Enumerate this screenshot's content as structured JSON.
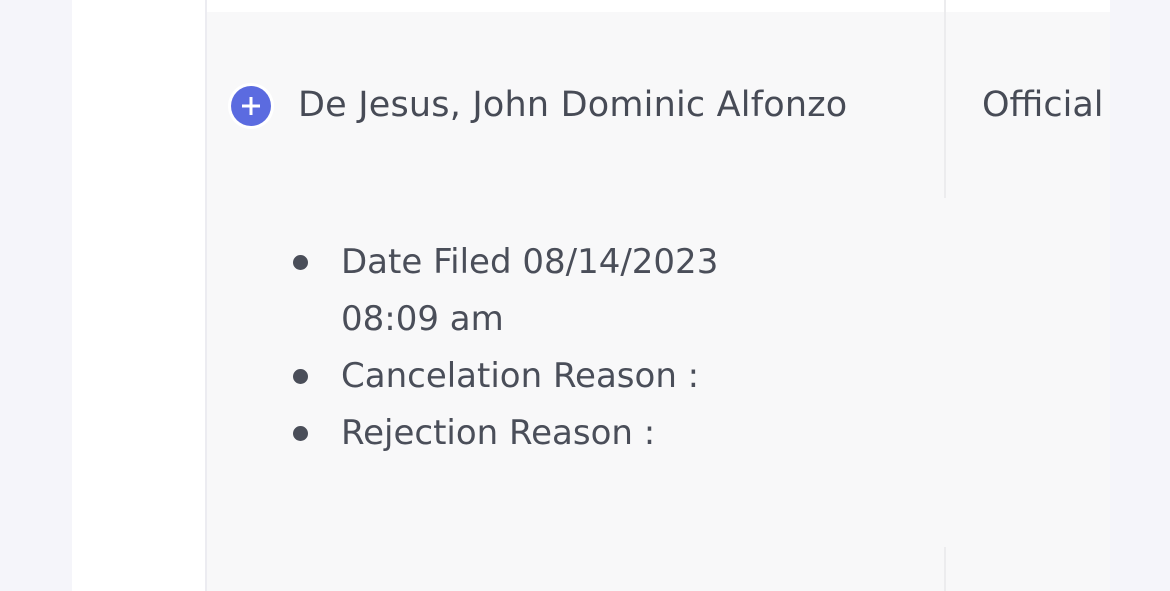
{
  "row": {
    "employee_name": "De Jesus, John Dominic Alfonzo",
    "type_partial": "Official",
    "expand_icon": "plus-icon",
    "accent_color": "#5b6be0"
  },
  "details": {
    "date_filed_line1": "Date Filed 08/14/2023",
    "date_filed_line2": "08:09 am",
    "cancelation_reason": "Cancelation Reason :",
    "rejection_reason": "Rejection Reason :"
  }
}
